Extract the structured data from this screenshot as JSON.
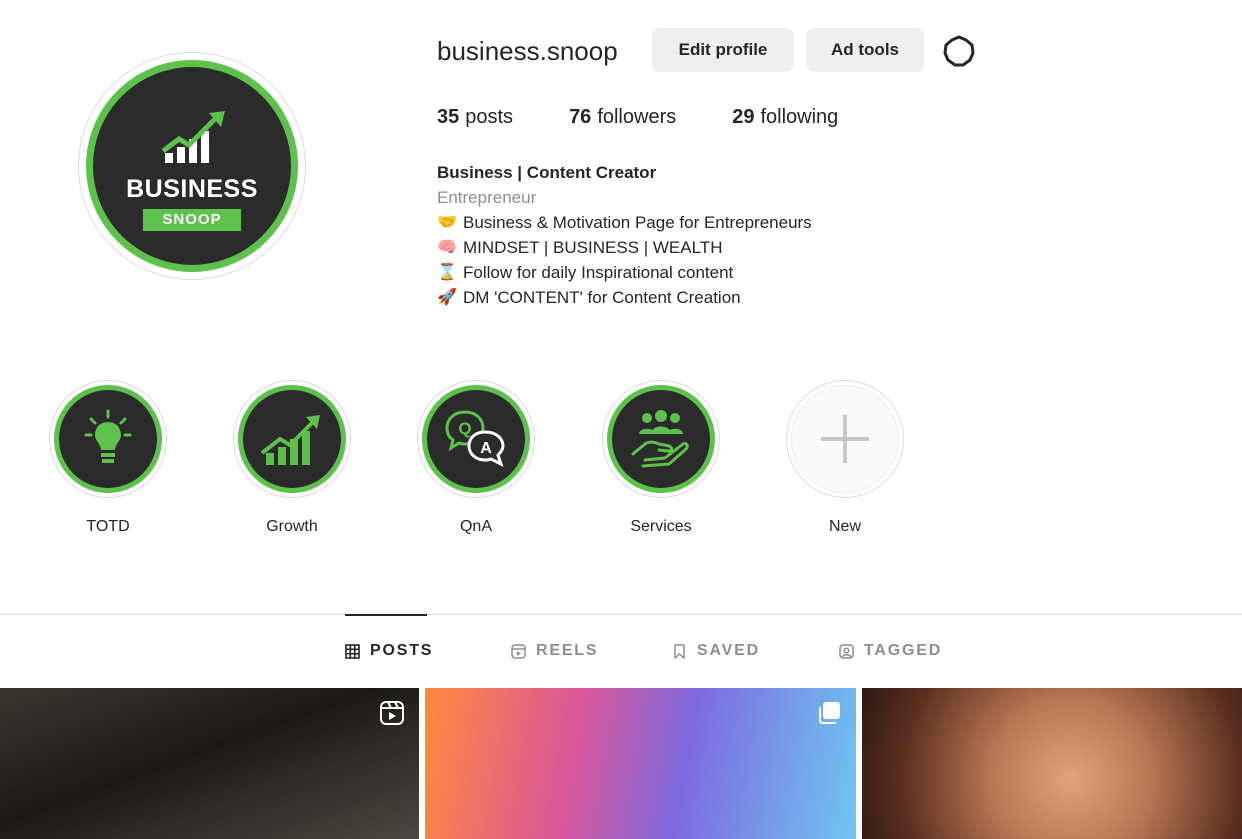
{
  "profile": {
    "username": "business.snoop",
    "edit_label": "Edit profile",
    "ad_label": "Ad tools",
    "avatar_word": "BUSINESS",
    "avatar_sub": "SNOOP",
    "accent_color": "#5dc24b"
  },
  "stats": {
    "posts_count": "35",
    "posts_label": "posts",
    "followers_count": "76",
    "followers_label": "followers",
    "following_count": "29",
    "following_label": "following"
  },
  "bio": {
    "name": "Business | Content Creator",
    "category": "Entrepreneur",
    "lines": [
      {
        "icon": "handshake-emoji",
        "glyph": "🤝",
        "text": "Business & Motivation Page for Entrepreneurs"
      },
      {
        "icon": "brain-emoji",
        "glyph": "🧠",
        "text": "MINDSET | BUSINESS | WEALTH"
      },
      {
        "icon": "hourglass-emoji",
        "glyph": "⌛",
        "text": "Follow for daily Inspirational content"
      },
      {
        "icon": "rocket-emoji",
        "glyph": "🚀",
        "text": "DM 'CONTENT' for Content Creation"
      }
    ]
  },
  "highlights": [
    {
      "label": "TOTD",
      "icon": "lightbulb-icon"
    },
    {
      "label": "Growth",
      "icon": "growth-chart-icon"
    },
    {
      "label": "QnA",
      "icon": "qna-bubbles-icon"
    },
    {
      "label": "Services",
      "icon": "people-hand-icon"
    },
    {
      "label": "New",
      "icon": "plus-icon"
    }
  ],
  "tabs": [
    {
      "label": "POSTS",
      "icon": "grid-icon",
      "active": true
    },
    {
      "label": "REELS",
      "icon": "reels-icon",
      "active": false
    },
    {
      "label": "SAVED",
      "icon": "bookmark-icon",
      "active": false
    },
    {
      "label": "TAGGED",
      "icon": "tagged-icon",
      "active": false
    }
  ],
  "posts": [
    {
      "type": "reel",
      "icon": "reel-icon"
    },
    {
      "type": "carousel",
      "icon": "carousel-icon"
    },
    {
      "type": "image",
      "icon": ""
    }
  ]
}
